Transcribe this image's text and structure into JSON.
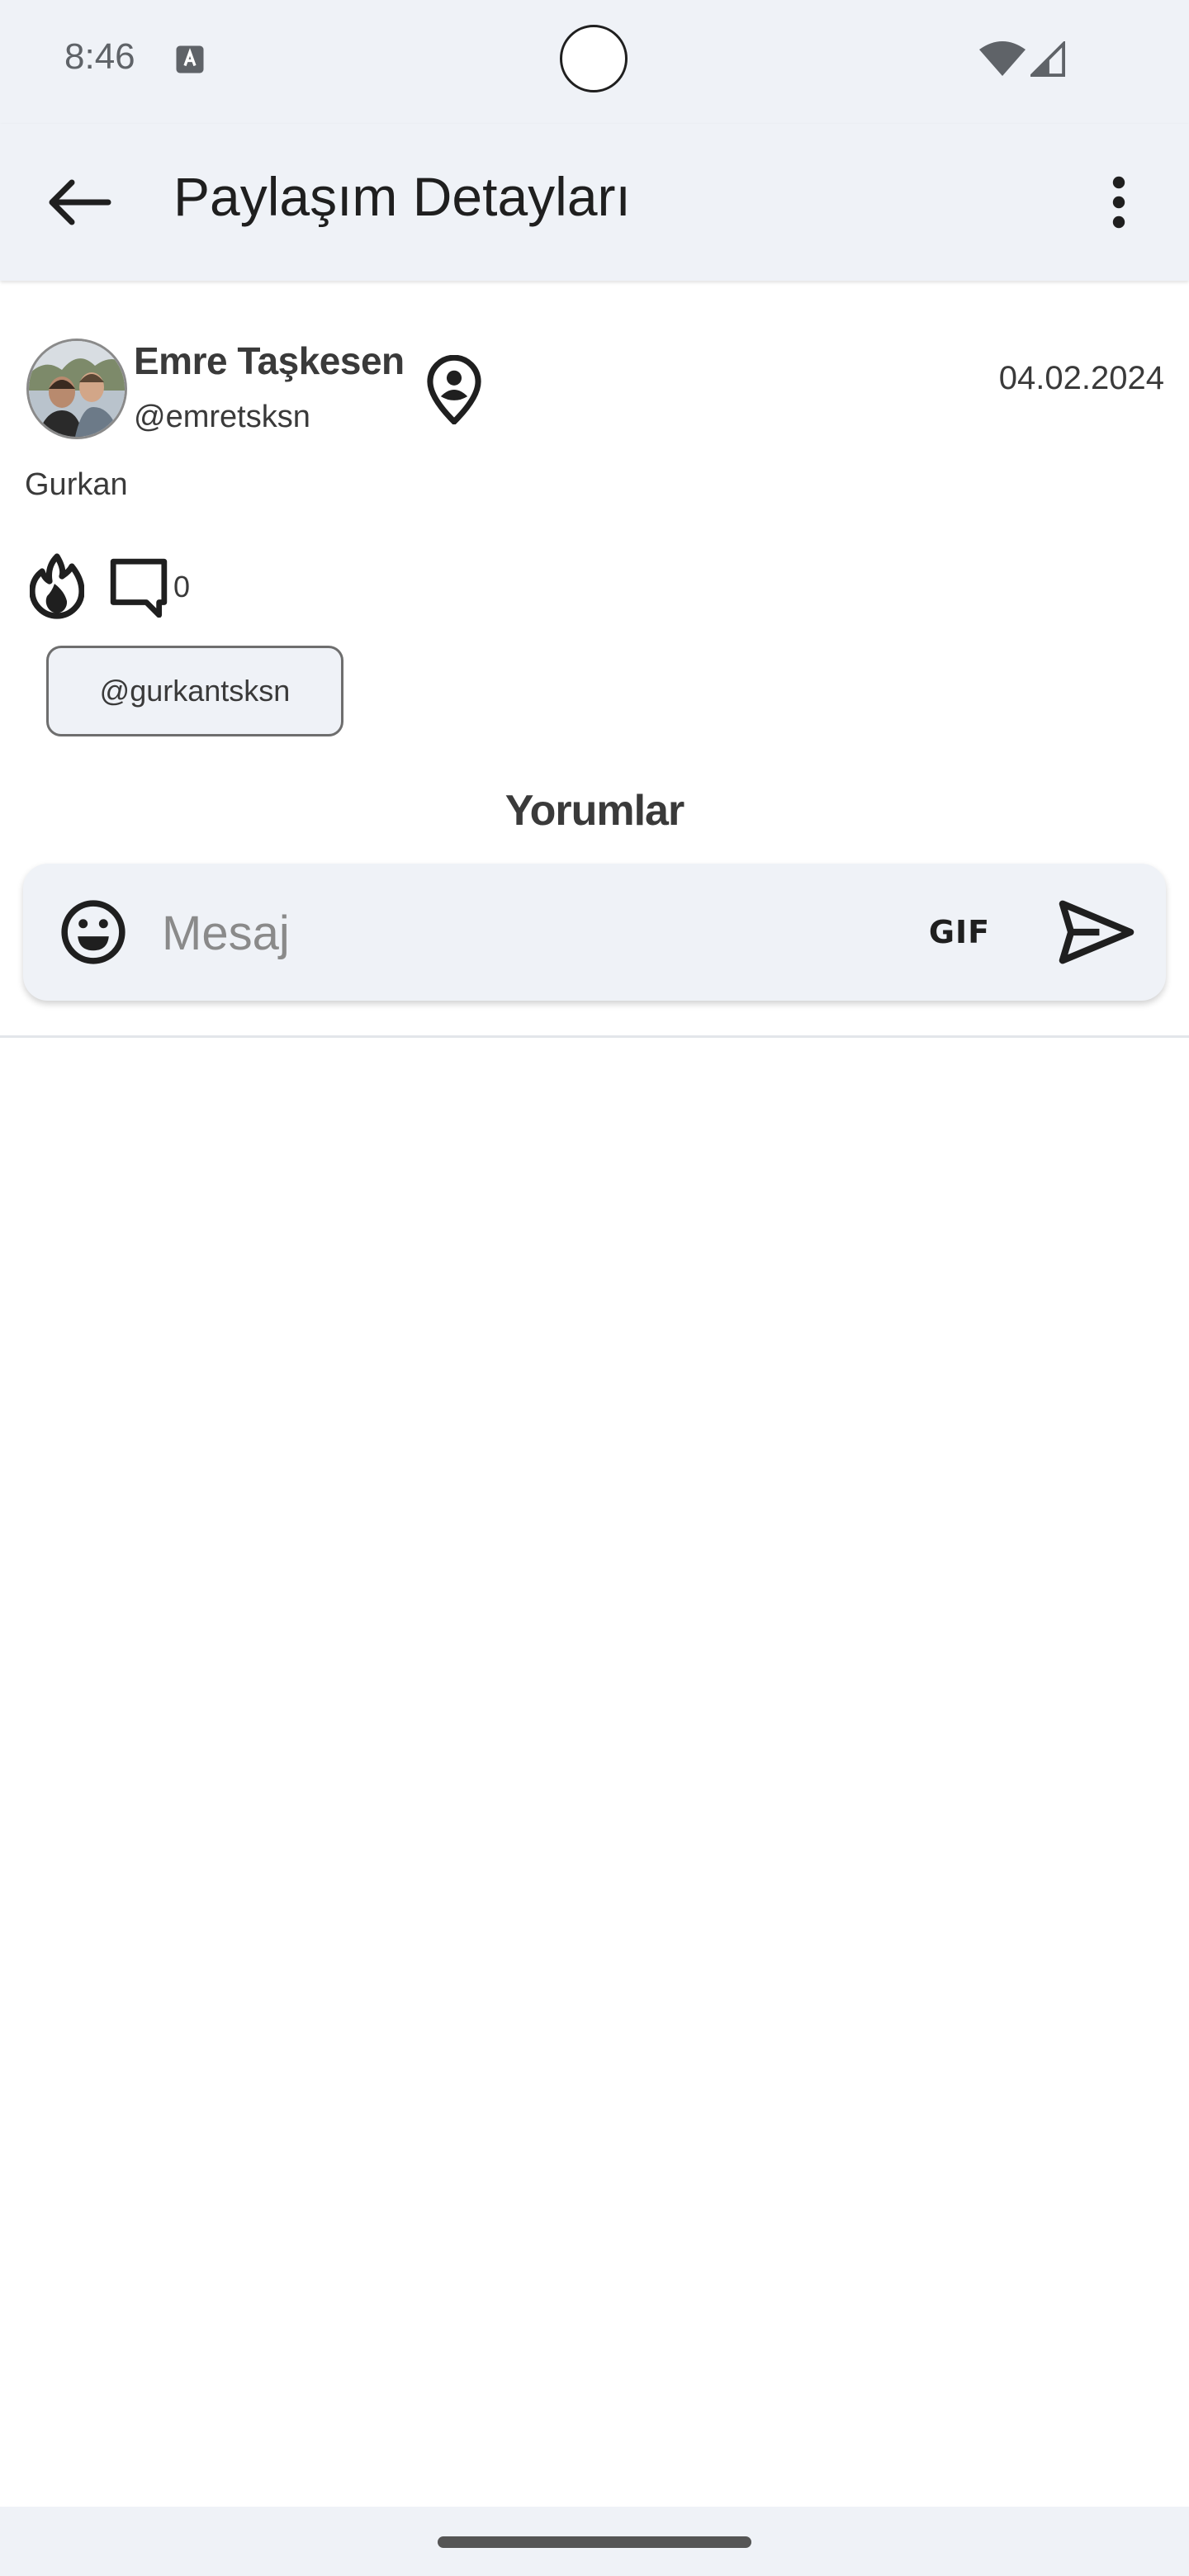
{
  "status_bar": {
    "time": "8:46",
    "icons": [
      "font-a-icon",
      "wifi-icon",
      "signal-icon"
    ]
  },
  "app_bar": {
    "title": "Paylaşım Detayları",
    "back_icon": "arrow-back-icon",
    "menu_icon": "more-vert-icon"
  },
  "post": {
    "author_name": "Emre Taşkesen",
    "author_handle": "@emretsksn",
    "date": "04.02.2024",
    "text": "Gurkan",
    "comment_count": "0",
    "mention": "@gurkantsksn",
    "icons": [
      "avatar-photo",
      "location-pin-icon",
      "fire-icon",
      "comment-icon"
    ]
  },
  "comments": {
    "section_title": "Yorumlar",
    "input_placeholder": "Mesaj",
    "gif_label": "GIF",
    "icons": [
      "emoji-icon",
      "send-icon"
    ]
  },
  "colors": {
    "surface": "#eff2f7",
    "text_primary": "#1f1f1f",
    "text_secondary": "#3a3a3a",
    "placeholder": "#8a8a8a",
    "background": "#ffffff"
  }
}
